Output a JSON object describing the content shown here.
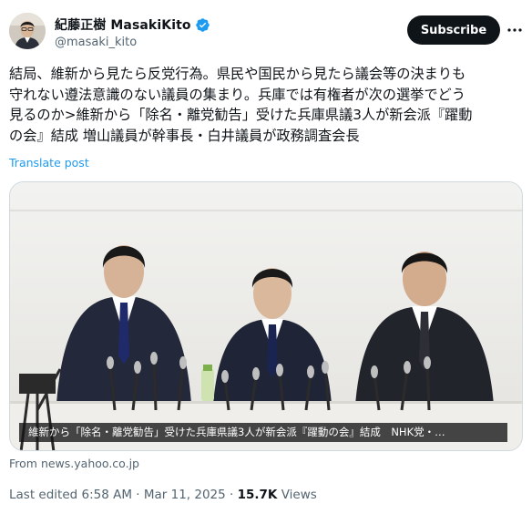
{
  "author": {
    "display_name": "紀藤正樹 MasakiKito",
    "handle": "@masaki_kito",
    "verified_color": "#1d9bf0"
  },
  "actions": {
    "subscribe_label": "Subscribe",
    "more_icon": "more-horizontal-icon"
  },
  "post": {
    "lines": [
      "結局、維新から見たら反党行為。県民や国民から見たら議会等の決まりも",
      "守れない遵法意識のない議員の集まり。兵庫では有権者が次の選挙でどう",
      "見るのか>維新から「除名・離党勧告」受けた兵庫県議3人が新会派『躍動",
      "の会』結成 増山議員が幹事長・白井議員が政務調査会長"
    ],
    "translate_label": "Translate post"
  },
  "media": {
    "caption": "維新から「除名・離党勧告」受けた兵庫県議3人が新会派『躍動の会』結成　NHK党・…",
    "source": "From news.yahoo.co.jp"
  },
  "meta": {
    "edited": "Last edited 6:58 AM · Mar 11, 2025 · ",
    "views_count": "15.7K",
    "views_label": " Views"
  },
  "colors": {
    "text": "#0f1419",
    "secondary": "#536471",
    "link": "#1d9bf0",
    "button_bg": "#0f1419"
  }
}
